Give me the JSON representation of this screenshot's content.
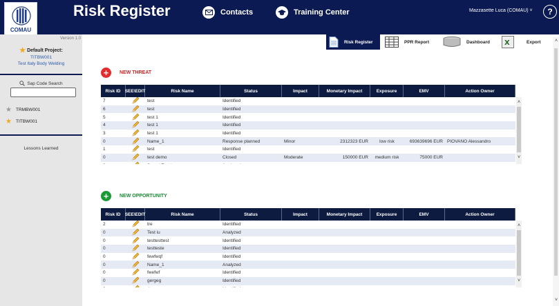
{
  "header": {
    "logo_text": "COMAU",
    "title": "Risk Register",
    "nav": [
      {
        "label": "Contacts",
        "icon": "envelope-icon"
      },
      {
        "label": "Training Center",
        "icon": "graduation-cap-icon"
      }
    ],
    "user": "Mazzasette Luca (COMAU)",
    "help_label": "?"
  },
  "sidebar": {
    "version": "Version 1.0",
    "default_project_label": "Default Project:",
    "project_code": "TITBW001",
    "project_name": "Test Italy Body Welding",
    "sap_search_label": "Sap Code Search",
    "sap_search_value": "",
    "favorites": [
      {
        "code": "TRMBW001",
        "starred": false
      },
      {
        "code": "TITBW001",
        "starred": true
      }
    ],
    "lessons_learned": "Lessons Learned"
  },
  "tabs": [
    {
      "label": "Risk Register",
      "icon": "document-icon",
      "active": true
    },
    {
      "label": "PPR Report",
      "icon": "grid-report-icon",
      "active": false
    },
    {
      "label": "Dashboard",
      "icon": "database-icon",
      "active": false
    },
    {
      "label": "Export",
      "icon": "excel-export-icon",
      "active": false
    }
  ],
  "columns": [
    "Risk ID",
    "SEE\\EDIT",
    "Risk Name",
    "Status",
    "Impact",
    "Monetary Impact",
    "Exposure",
    "EMV",
    "Action Owner"
  ],
  "threat": {
    "label": "NEW THREAT",
    "rows": [
      {
        "id": "7",
        "name": "test",
        "status": "Identified",
        "impact": "",
        "money": "",
        "exposure": "",
        "emv": "",
        "owner": ""
      },
      {
        "id": "6",
        "name": "test",
        "status": "Identified",
        "impact": "",
        "money": "",
        "exposure": "",
        "emv": "",
        "owner": ""
      },
      {
        "id": "5",
        "name": "test 1",
        "status": "Identified",
        "impact": "",
        "money": "",
        "exposure": "",
        "emv": "",
        "owner": ""
      },
      {
        "id": "4",
        "name": "test 1",
        "status": "Identified",
        "impact": "",
        "money": "",
        "exposure": "",
        "emv": "",
        "owner": ""
      },
      {
        "id": "3",
        "name": "test 1",
        "status": "Identified",
        "impact": "",
        "money": "",
        "exposure": "",
        "emv": "",
        "owner": ""
      },
      {
        "id": "0",
        "name": "Name_1",
        "status": "Response planned",
        "impact": "Minor",
        "money": "2312323 EUR",
        "exposure": "low risk",
        "emv": "693639696 EUR",
        "owner": "PIOVANO Alessandro"
      },
      {
        "id": "1",
        "name": "test",
        "status": "Identified",
        "impact": "",
        "money": "",
        "exposure": "",
        "emv": "",
        "owner": ""
      },
      {
        "id": "0",
        "name": "test demo",
        "status": "Closed",
        "impact": "Moderate",
        "money": "150000 EUR",
        "exposure": "medium risk",
        "emv": "75000 EUR",
        "owner": ""
      },
      {
        "id": "0",
        "name": "Speed Test iu",
        "status": "Analyzed",
        "impact": "",
        "money": "",
        "exposure": "",
        "emv": "",
        "owner": ""
      }
    ]
  },
  "opportunity": {
    "label": "NEW OPPORTUNITY",
    "rows": [
      {
        "id": "2",
        "name": "tre",
        "status": "Identified",
        "impact": "",
        "money": "",
        "exposure": "",
        "emv": "",
        "owner": ""
      },
      {
        "id": "0",
        "name": "Test iu",
        "status": "Analyzed",
        "impact": "",
        "money": "",
        "exposure": "",
        "emv": "",
        "owner": ""
      },
      {
        "id": "0",
        "name": "testtesttest",
        "status": "Identified",
        "impact": "",
        "money": "",
        "exposure": "",
        "emv": "",
        "owner": ""
      },
      {
        "id": "0",
        "name": "testteste",
        "status": "Identified",
        "impact": "",
        "money": "",
        "exposure": "",
        "emv": "",
        "owner": ""
      },
      {
        "id": "0",
        "name": "fewfwqf",
        "status": "Identified",
        "impact": "",
        "money": "",
        "exposure": "",
        "emv": "",
        "owner": ""
      },
      {
        "id": "0",
        "name": "Name_1",
        "status": "Analyzed",
        "impact": "",
        "money": "",
        "exposure": "",
        "emv": "",
        "owner": ""
      },
      {
        "id": "0",
        "name": "fwefwf",
        "status": "Identified",
        "impact": "",
        "money": "",
        "exposure": "",
        "emv": "",
        "owner": ""
      },
      {
        "id": "0",
        "name": "gergeg",
        "status": "Identified",
        "impact": "",
        "money": "",
        "exposure": "",
        "emv": "",
        "owner": ""
      },
      {
        "id": "0",
        "name": "dgeger",
        "status": "Identified",
        "impact": "",
        "money": "",
        "exposure": "",
        "emv": "",
        "owner": ""
      }
    ]
  },
  "colors": {
    "navy": "#0b1a52",
    "threat_red": "#e32d2d",
    "opportunity_green": "#1a9a35",
    "row_alt": "#e6eaf4"
  }
}
